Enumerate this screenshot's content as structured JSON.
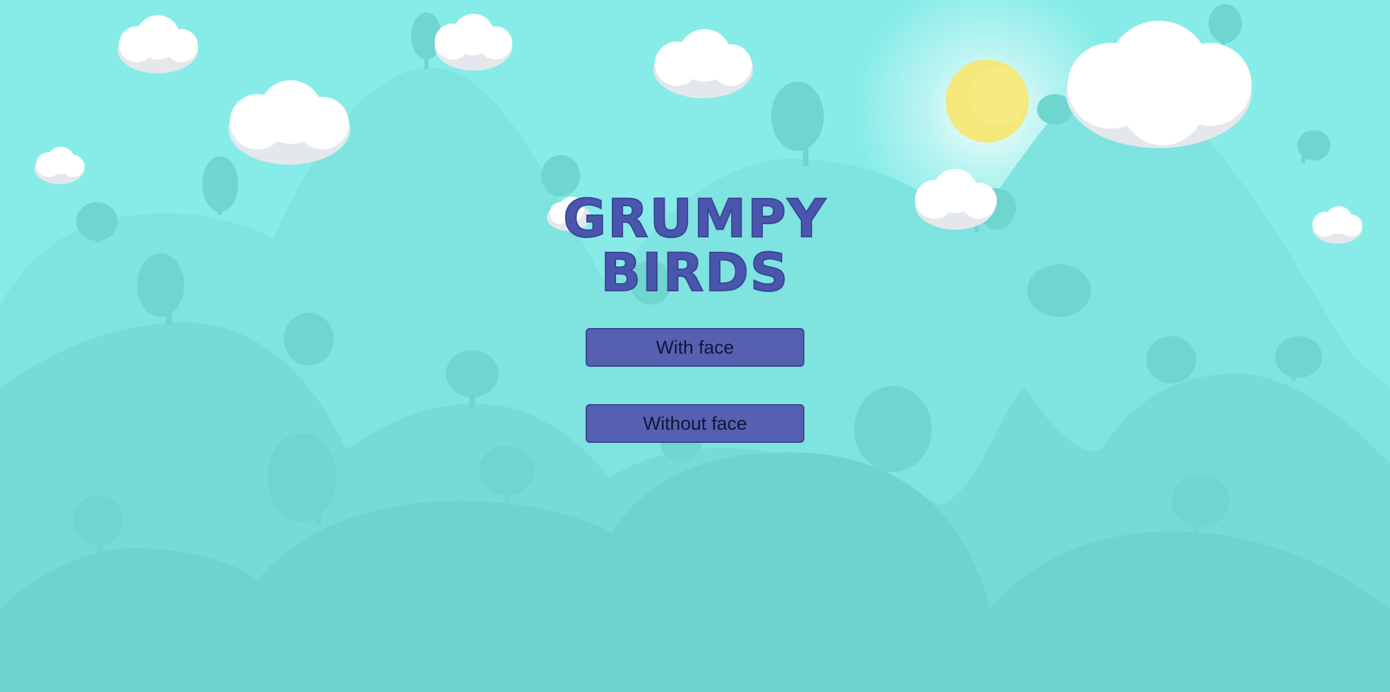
{
  "title": {
    "line1": "GRUMPY",
    "line2": "BIRDS"
  },
  "menu": {
    "with_face_label": "With face",
    "without_face_label": "Without face"
  },
  "colors": {
    "sky": "#87ece8",
    "far_hills": "#7fe3df",
    "mid_hills": "#76dbd6",
    "near_hills": "#6dd4cd",
    "trees": "#6ed5cf",
    "sun": "#f5e87a",
    "cloud": "#ffffff",
    "cloud_shadow": "#e4e8ec",
    "title_text": "#4a56ad",
    "button_fill": "#5561b0",
    "button_text": "#11163a"
  }
}
